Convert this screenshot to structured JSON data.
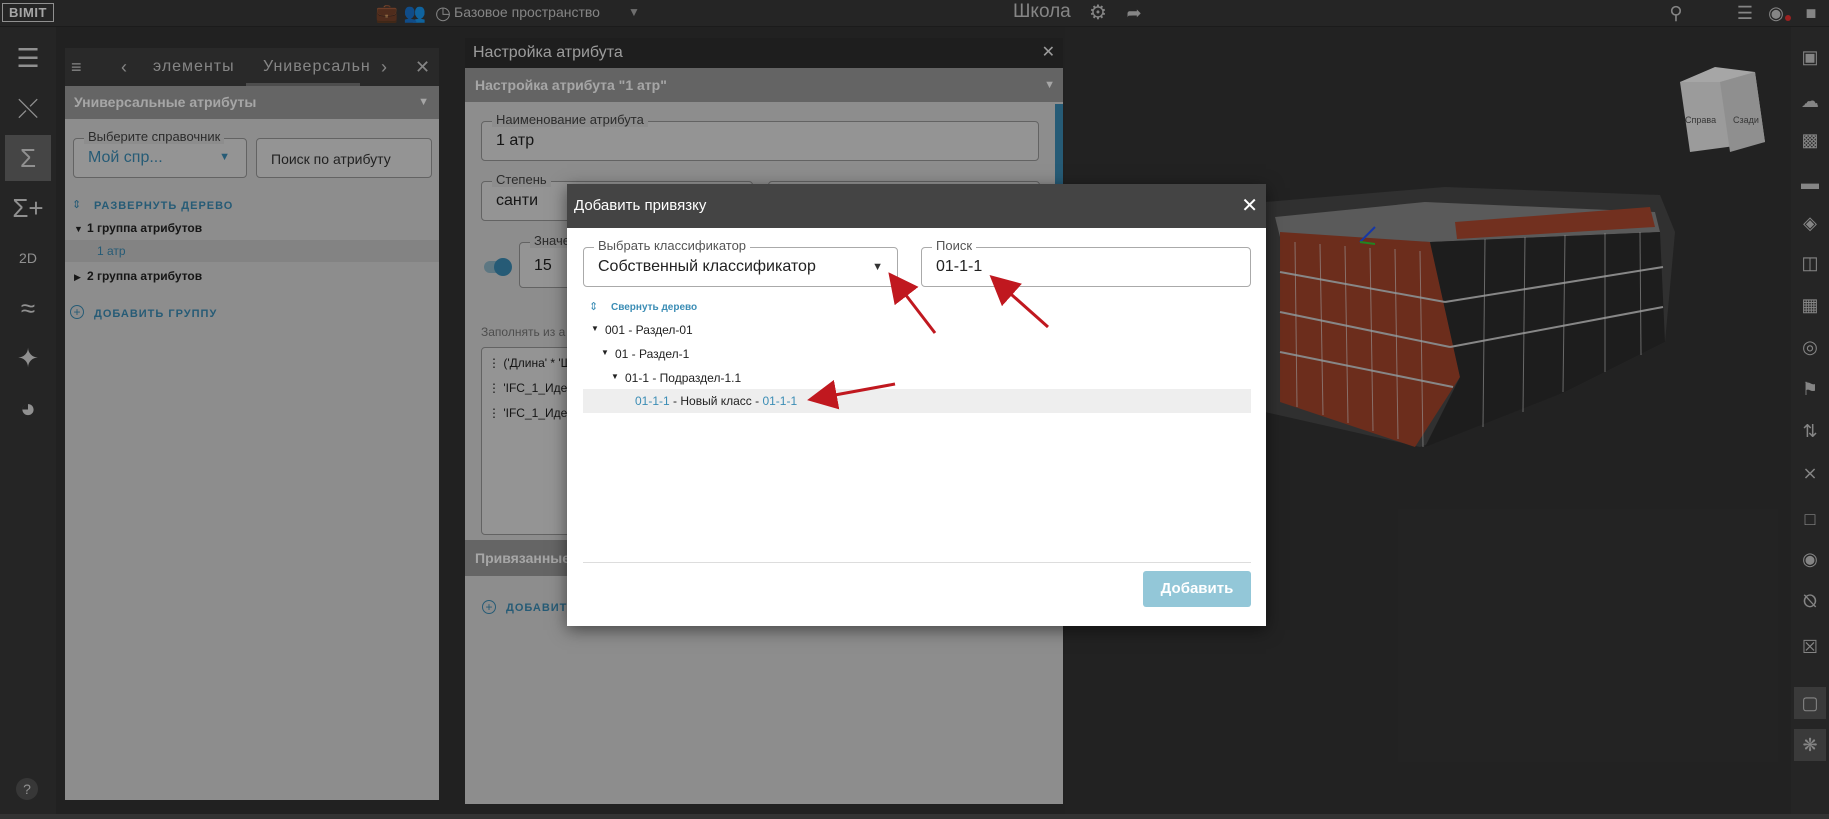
{
  "topbar": {
    "logo": "BIMIT",
    "space_name": "Базовое пространство",
    "project_name": "Школа"
  },
  "left_rail": {
    "icons": [
      "tree-icon",
      "shuffle-icon",
      "sigma-icon",
      "sigma-plus-icon",
      "2d-icon",
      "chart-line-icon",
      "puzzle-icon",
      "gauge-icon"
    ],
    "active_index": 2,
    "help": "?"
  },
  "attr_panel": {
    "tabs": [
      "элементы",
      "Универсальн"
    ],
    "header": "Универсальные атрибуты",
    "dictionary_label": "Выберите справочник",
    "dictionary_value": "Мой спр...",
    "search_placeholder": "Поиск по атрибуту",
    "expand_tree": "РАЗВЕРНУТЬ ДЕРЕВО",
    "groups": [
      {
        "label": "1 группа атрибутов",
        "expanded": true,
        "children": [
          "1 атр"
        ]
      },
      {
        "label": "2 группа атрибутов",
        "expanded": false,
        "children": []
      }
    ],
    "add_group": "ДОБАВИТЬ ГРУППУ"
  },
  "settings_panel": {
    "title": "Настройка атрибута",
    "subtitle": "Настройка атрибута \"1 атр\"",
    "name_label": "Наименование атрибута",
    "name_value": "1 атр",
    "degree_label": "Степень",
    "degree_value": "санти",
    "value_label": "Значе",
    "value_value": "15",
    "fill_from": "Заполнять из а",
    "formulas": [
      "('Длина' * 'Ш",
      "'IFC_1_Идент",
      "'IFC_1_Идент"
    ],
    "linked_header": "Привязанные",
    "add_link": "ДОБАВИТЬ"
  },
  "viewer": {
    "navcube_left": "Справа",
    "navcube_front": "Сзади"
  },
  "dialog": {
    "title": "Добавить привязку",
    "classifier_label": "Выбрать классификатор",
    "classifier_value": "Собственный классификатор",
    "search_label": "Поиск",
    "search_value": "01-1-1",
    "collapse_tree": "Свернуть дерево",
    "tree": [
      {
        "label": "001 - Раздел-01"
      },
      {
        "label": "01 - Раздел-1"
      },
      {
        "label": "01-1 - Подраздел-1.1"
      },
      {
        "code": "01-1-1",
        "middle": " - Новый класс - ",
        "code2": "01-1-1"
      }
    ],
    "add_button": "Добавить"
  },
  "colors": {
    "accent": "#3b8db5",
    "arrow": "#c0181f",
    "building_brick": "#a7452c"
  }
}
